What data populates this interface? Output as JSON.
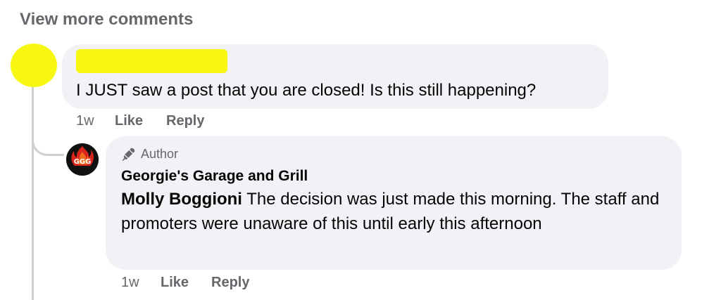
{
  "view_more": {
    "label": "View more comments"
  },
  "comment": {
    "text": "I JUST saw a post that you are closed! Is this still happening?",
    "time": "1w",
    "like_label": "Like",
    "reply_label": "Reply"
  },
  "reply": {
    "badge_icon": "microphone-icon",
    "badge_label": "Author",
    "page_name": "Georgie's Garage and Grill",
    "mention": "Molly Boggioni",
    "text": " The decision was just made this morning. The staff and promoters were unaware of this until early this afternoon",
    "time": "1w",
    "like_label": "Like",
    "reply_label": "Reply",
    "avatar_text": "GGG"
  },
  "colors": {
    "bubble": "#f0f2f5",
    "meta_text": "#65676b",
    "redaction": "#f7f711",
    "thread_line": "#ced0d4"
  }
}
